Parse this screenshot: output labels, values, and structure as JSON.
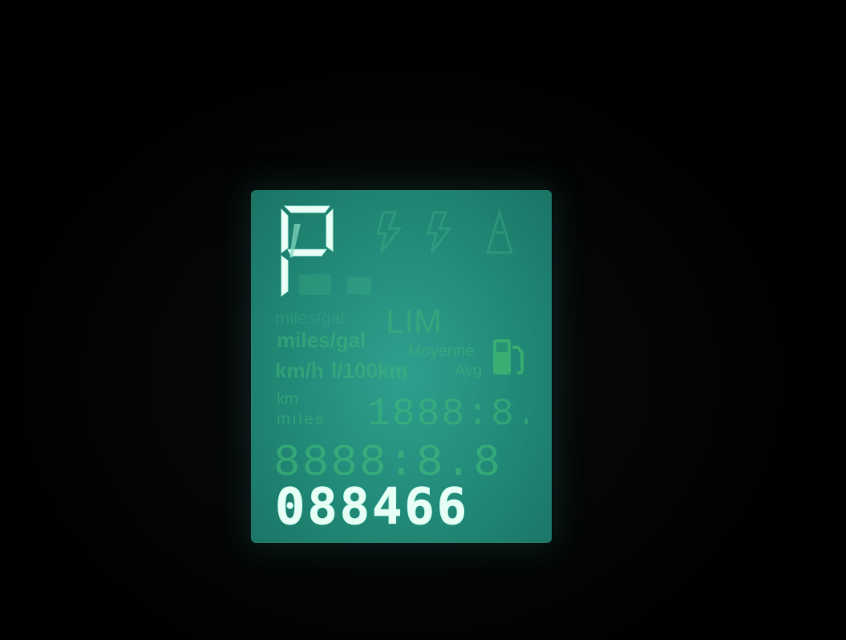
{
  "display": {
    "gear": "P",
    "ghost_units": [
      "miles/gal",
      "km/h",
      "l/100km",
      "km",
      "miles"
    ],
    "ghost_words": [
      "LIM",
      "Moyenne",
      "Avg"
    ],
    "trip_segments": "1888:8.8",
    "clock_segments": "8888:8.8",
    "odometer": "088466"
  },
  "colors": {
    "lcd_background": "#228977",
    "lit_segment": "#e8fff6",
    "unlit_segment": "#3fb47a"
  },
  "icons": [
    "fuel-pump-icon"
  ]
}
